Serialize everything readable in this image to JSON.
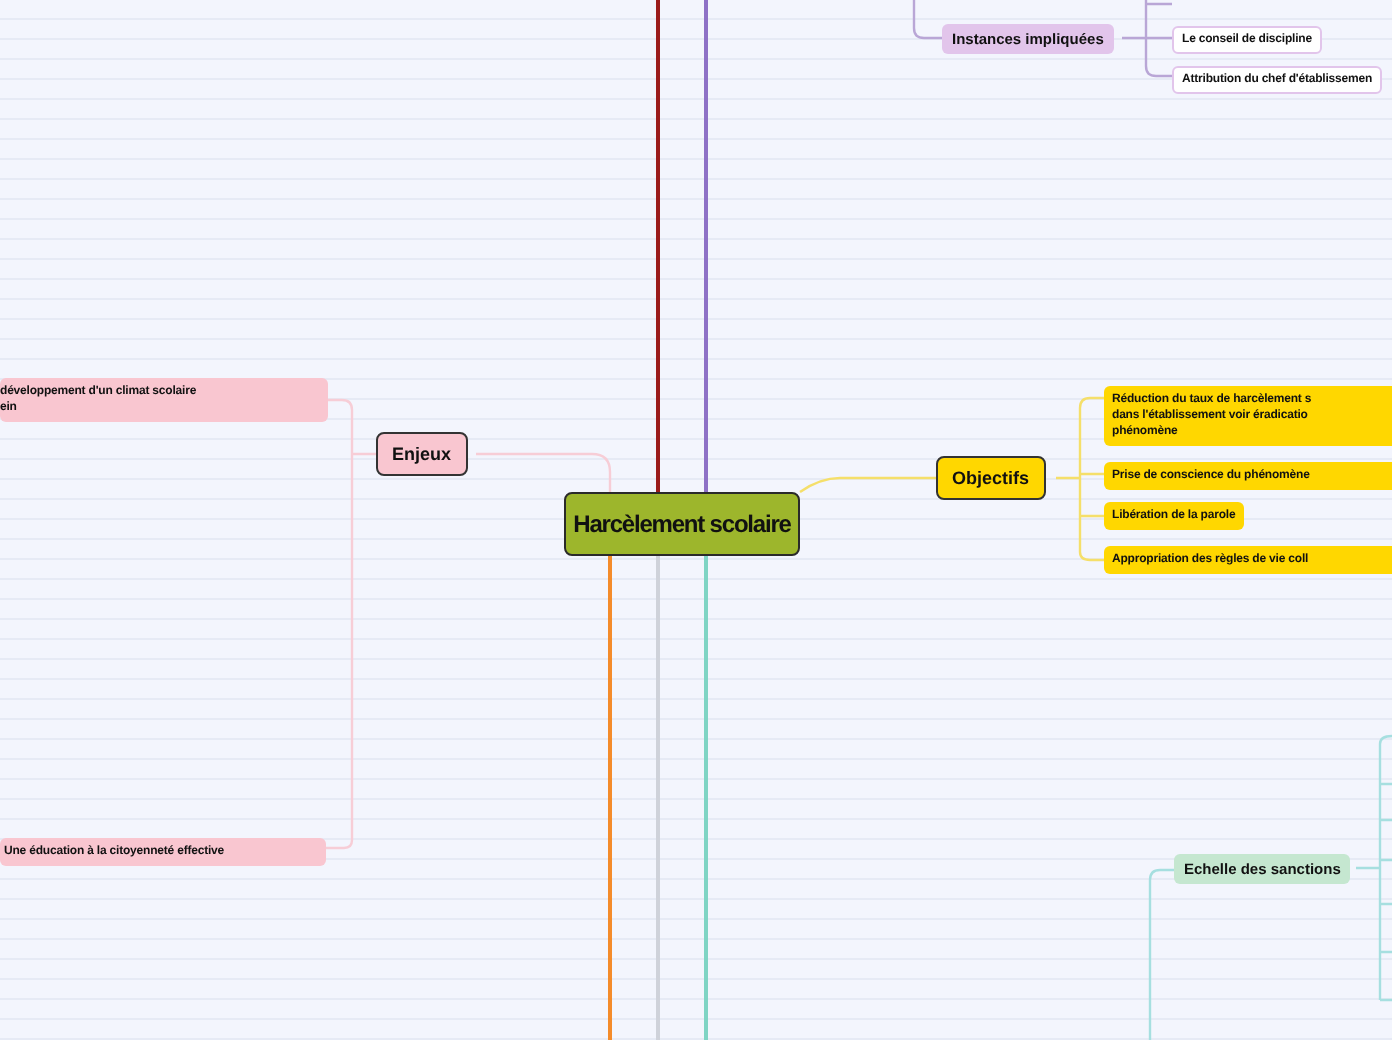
{
  "central": {
    "label": "Harcèlement scolaire"
  },
  "branches": [
    {
      "label": "Instances impliquées",
      "color": "#e2c5eb",
      "kind": "outlined",
      "children": [
        {
          "label": "Le conseil de discipline"
        },
        {
          "label": "Attribution du chef d'établissemen"
        }
      ]
    },
    {
      "label": "Enjeux",
      "color": "#f9c6d0",
      "kind": "filled",
      "children": [
        {
          "label": "développement d'un climat scolaire\nein"
        },
        {
          "label": "Une éducation à la citoyenneté effective"
        }
      ]
    },
    {
      "label": "Objectifs",
      "color": "#ffd700",
      "kind": "filled",
      "children": [
        {
          "label": "Réduction du taux de harcèlement s\ndans l'établissement voir éradicatio\nphénomène"
        },
        {
          "label": "Prise de conscience du phénomène"
        },
        {
          "label": "Libération de la parole"
        },
        {
          "label": "Appropriation des règles de vie coll"
        }
      ]
    },
    {
      "label": "Echelle des sanctions",
      "color": "#c5e7d0",
      "kind": "outlined"
    }
  ]
}
